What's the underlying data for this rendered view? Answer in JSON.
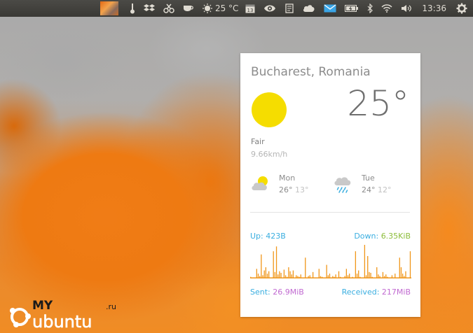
{
  "panel": {
    "temperature": "25 °C",
    "time": "13:36",
    "icons": [
      "wallpaper-thumbnail",
      "thermometer-icon",
      "dropbox-icon",
      "clipboard-scissors-icon",
      "cup-icon",
      "weather-sun-icon",
      "calendar-icon",
      "eye-icon",
      "notes-icon",
      "cloud-icon",
      "mail-icon",
      "battery-icon",
      "bluetooth-icon",
      "wifi-icon",
      "volume-icon",
      "gear-icon"
    ],
    "colors": {
      "bg": "#3f3e3a",
      "fg": "#dfdbd2",
      "mail": "#3aa5e6"
    }
  },
  "weather": {
    "location": "Bucharest, Romania",
    "temperature": "25°",
    "condition": "Fair",
    "wind": "9.66km/h",
    "forecast": [
      {
        "day": "Mon",
        "high": "26°",
        "low": "13°",
        "icon": "partly-cloudy-icon"
      },
      {
        "day": "Tue",
        "high": "24°",
        "low": "12°",
        "icon": "rain-icon"
      }
    ],
    "colors": {
      "sun": "#f5dd00"
    }
  },
  "network": {
    "up_label": "Up:",
    "up_value": "423B",
    "down_label": "Down:",
    "down_value": "6.35KiB",
    "sent_label": "Sent:",
    "sent_value": "26.9MiB",
    "received_label": "Received:",
    "received_value": "217MiB",
    "graph_values": [
      2,
      0,
      0,
      0,
      12,
      6,
      3,
      30,
      4,
      10,
      14,
      6,
      9,
      0,
      0,
      34,
      8,
      40,
      5,
      9,
      7,
      0,
      11,
      4,
      2,
      14,
      9,
      5,
      10,
      0,
      4,
      3,
      2,
      5,
      0,
      0,
      26,
      0,
      3,
      4,
      0,
      8,
      0,
      0,
      0,
      12,
      3,
      2,
      0,
      0,
      17,
      4,
      6,
      0,
      3,
      2,
      5,
      0,
      9,
      2,
      0,
      0,
      3,
      12,
      4,
      6,
      0,
      2,
      0,
      34,
      6,
      10,
      2,
      0,
      0,
      42,
      4,
      28,
      8,
      7,
      2,
      0,
      0,
      14,
      5,
      3,
      0,
      8,
      3,
      5,
      2,
      0,
      0,
      4,
      0,
      6,
      0,
      0,
      26,
      14,
      6,
      3,
      9,
      0,
      0,
      34
    ],
    "colors": {
      "up": "#3aaee0",
      "down_value": "#8cbd3a",
      "sent_value": "#c16ad1",
      "bars": "#f0961a"
    }
  },
  "watermark": {
    "brand_top": "MY",
    "brand_bottom": "ubuntu",
    "suffix": ".ru"
  }
}
